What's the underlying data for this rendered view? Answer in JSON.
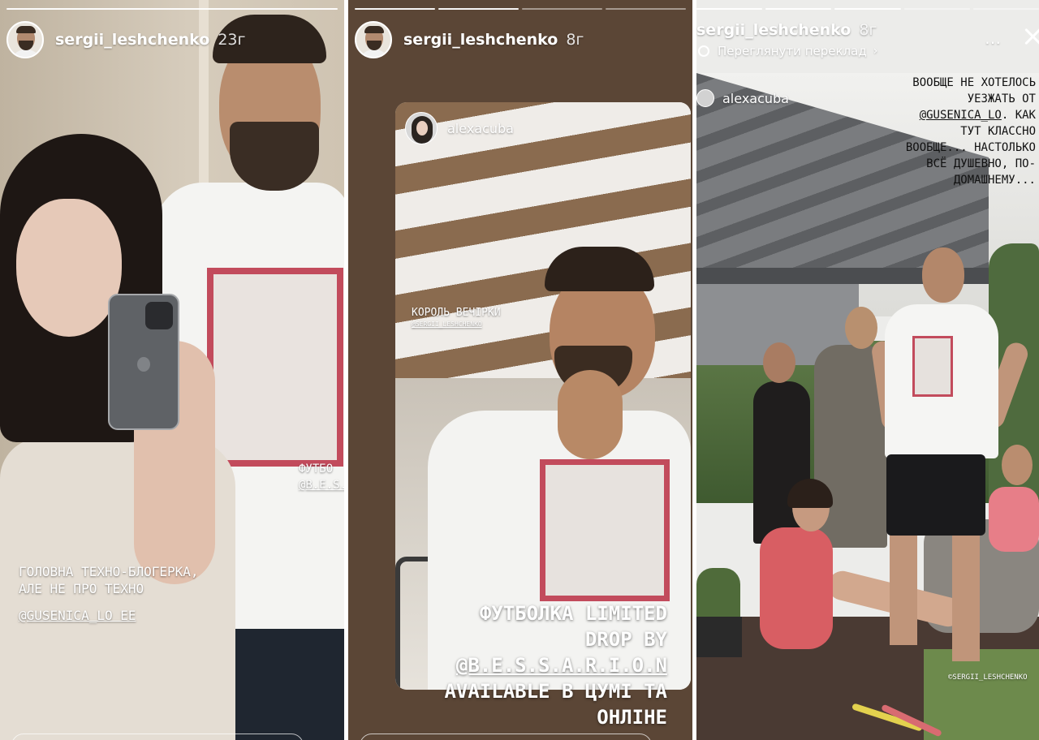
{
  "stories": [
    {
      "username": "sergii_leshchenko",
      "time": "23г",
      "caption_lines": [
        "ГОЛОВНА ТЕХНО-БЛОГЕРКА,",
        "АЛЕ НЕ ПРО ТЕХНО"
      ],
      "mention": "@GUSENICA_LO EE",
      "shirt_lines": [
        "ФУТБО",
        "@B.E.S.S."
      ]
    },
    {
      "username": "sergii_leshchenko",
      "time": "8г",
      "reshared_from": "alexacuba",
      "small_caption": "КОРОЛЬ ВЕЧІРКИ",
      "small_mention": "@SERGII_LESHCHENKO",
      "big_caption": {
        "line1": "ФУТБОЛКА LIMITED",
        "line2": "DROP BY",
        "line3": "@B.E.S.S.A.R.I.O.N",
        "line4": "AVAILABLE В ЦУМІ ТА",
        "line5": "ОНЛІНЕ"
      }
    },
    {
      "username": "sergii_leshchenko",
      "time": "8г",
      "translate_label": "Переглянути переклад",
      "reshared_from": "alexacuba",
      "caption": {
        "line1": "ВООБЩЕ НЕ ХОТЕЛОСЬ",
        "line2": "УЕЗЖАТЬ ОТ",
        "line3_mention": "@GUSENICA_LO",
        "line3_rest": ". КАК",
        "line4": "ТУТ КЛАССНО",
        "line5": "ВООБЩЕ... НАСТОЛЬКО",
        "line6": "ВСЁ ДУШЕВНО, ПО-",
        "line7": "ДОМАШНЕМУ..."
      },
      "photo_credit": "©SERGII_LESHCHENKO"
    }
  ],
  "icons": {
    "more": "⋯",
    "chevron": "›"
  }
}
